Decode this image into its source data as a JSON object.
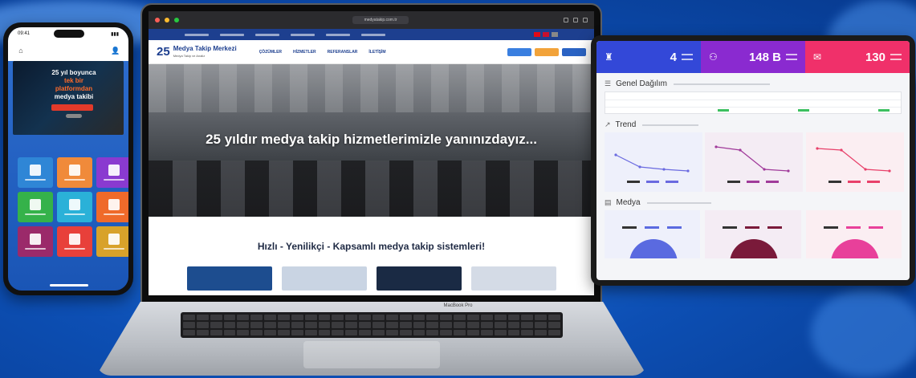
{
  "phone": {
    "status_time": "09:41",
    "banner_text": [
      "25 yıl boyunca",
      "tek bir",
      "platformdan",
      "medya takibi"
    ],
    "apps": [
      {
        "color": "#2f86d6"
      },
      {
        "color": "#f08a3a"
      },
      {
        "color": "#8a3ad0"
      },
      {
        "color": "#35b24a"
      },
      {
        "color": "#2ab1d8"
      },
      {
        "color": "#ef6a2a"
      },
      {
        "color": "#9b2a6a"
      },
      {
        "color": "#e8403a"
      },
      {
        "color": "#d8a22a"
      }
    ]
  },
  "laptop": {
    "url": "medyatakip.com.tr",
    "logo_mark": "25",
    "logo_text": "Medya Takip Merkezi",
    "logo_sub": "Medya Takip ve Analiz",
    "nav": [
      "ÇÖZÜMLER",
      "HİZMETLER",
      "REFERANSLAR",
      "İLETİŞİM"
    ],
    "nav_buttons": [
      "#3a7fe0",
      "#f2a33a",
      "#2a63c4"
    ],
    "hero_title": "25 yıldır medya takip hizmetlerimizle yanınızdayız...",
    "section_title": "Hızlı - Yenilikçi - Kapsamlı medya takip sistemleri!",
    "thumbs": [
      "#1d4d8f",
      "#c9d4e3",
      "#1a2a44",
      "#d4dbe6"
    ],
    "model_label": "MacBook Pro"
  },
  "tablet": {
    "stats": [
      {
        "value": "4",
        "color": "#3348d8",
        "icon": "user-icon"
      },
      {
        "value": "148 B",
        "color": "#8a2ad0",
        "icon": "group-icon"
      },
      {
        "value": "130",
        "color": "#f0306a",
        "icon": "message-icon"
      }
    ],
    "panels": [
      {
        "title": "Genel Dağılım",
        "icon": "list-icon"
      },
      {
        "title": "Trend",
        "icon": "trend-icon"
      },
      {
        "title": "Medya",
        "icon": "media-icon"
      }
    ],
    "trend_colors": [
      "#6a6ae0",
      "#a03a9a",
      "#e8406a"
    ],
    "pie_colors": [
      "#5a6ae0",
      "#7a1a3a",
      "#e8409a"
    ]
  }
}
